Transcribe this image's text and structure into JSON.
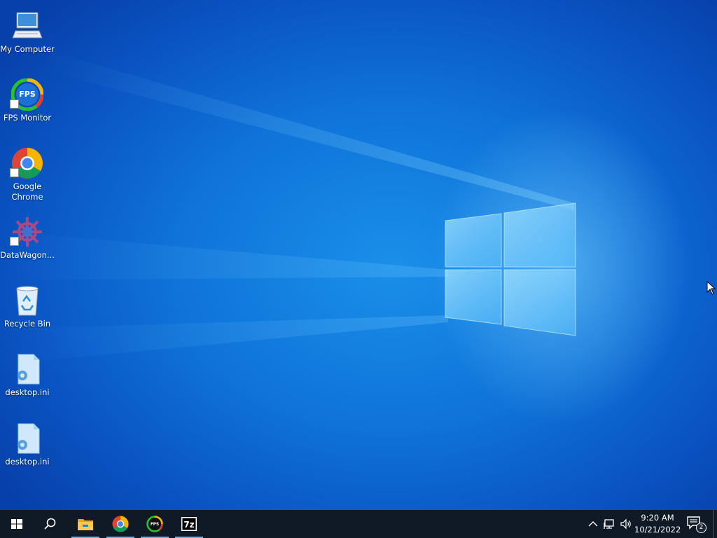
{
  "desktop": {
    "icons": [
      {
        "label": "My Computer",
        "icon": "computer-icon",
        "shortcut": false
      },
      {
        "label": "FPS Monitor",
        "icon": "fps-monitor-icon",
        "shortcut": true
      },
      {
        "label": "Google Chrome",
        "icon": "chrome-icon",
        "shortcut": true
      },
      {
        "label": "DataWagon...",
        "icon": "datawagon-icon",
        "shortcut": true
      },
      {
        "label": "Recycle Bin",
        "icon": "recycle-bin-icon",
        "shortcut": false
      },
      {
        "label": "desktop.ini",
        "icon": "settings-file-icon",
        "shortcut": false
      },
      {
        "label": "desktop.ini",
        "icon": "settings-file-icon",
        "shortcut": false
      }
    ],
    "wallpaper_colors": {
      "deep": "#0740aa",
      "mid": "#0f73d8",
      "glow": "#8fd6ff"
    }
  },
  "taskbar": {
    "background": "#101a26",
    "start_icon": "windows-start-icon",
    "search_icon": "search-icon",
    "pinned": [
      {
        "name": "file-explorer",
        "icon": "folder-icon",
        "active": true
      },
      {
        "name": "chrome",
        "icon": "chrome-icon",
        "active": true
      },
      {
        "name": "fps-monitor",
        "icon": "fps-monitor-icon",
        "active": true
      },
      {
        "name": "7-zip",
        "icon": "7zip-icon",
        "label": "7z",
        "active": true
      }
    ],
    "tray": {
      "overflow_icon": "chevron-up-icon",
      "network_icon": "network-icon",
      "volume_icon": "volume-icon",
      "time": "9:20 AM",
      "date": "10/21/2022",
      "notifications_count": "2"
    }
  }
}
